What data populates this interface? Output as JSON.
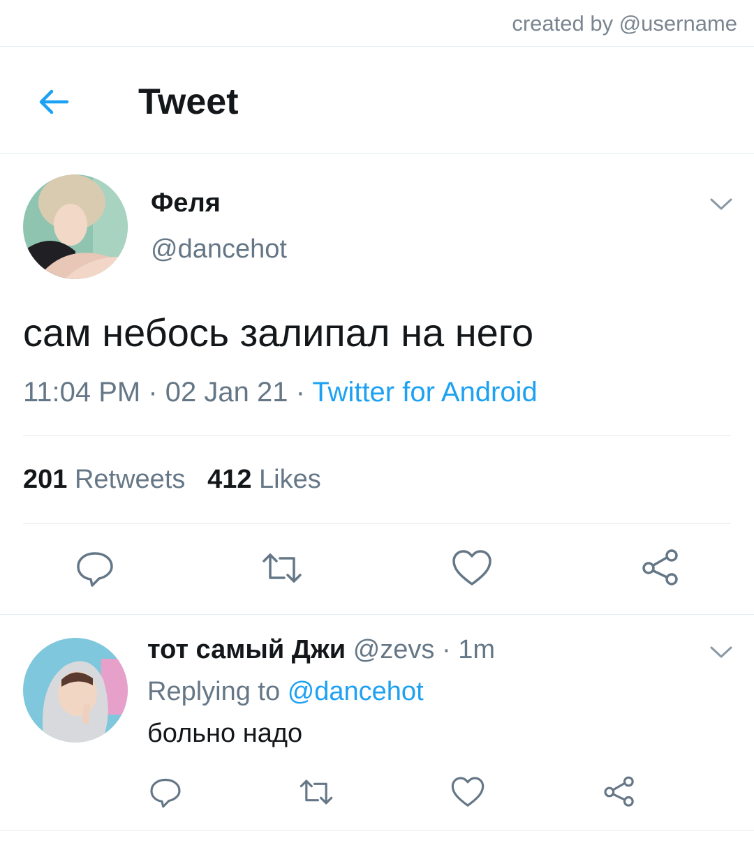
{
  "watermark": "created by @username",
  "header": {
    "back_icon": "arrow-left-icon",
    "title": "Tweet"
  },
  "colors": {
    "accent": "#1da1f2",
    "secondary_text": "#657786",
    "divider": "#e6ecf0"
  },
  "tweet": {
    "author_name": "Феля",
    "author_handle": "@dancehot",
    "text": "сам небось залипал на него",
    "time": "11:04 PM",
    "date": "02 Jan 21",
    "sep1": " · ",
    "sep2": " · ",
    "source": "Twitter for Android",
    "retweets_count": "201",
    "retweets_label": "Retweets",
    "likes_count": "412",
    "likes_label": "Likes",
    "actions": [
      "reply-icon",
      "retweet-icon",
      "like-icon",
      "share-icon"
    ]
  },
  "reply": {
    "author_name": "тот самый Джи",
    "author_handle": "@zevs",
    "separator": " · ",
    "time": "1m",
    "replying_prefix": "Replying to",
    "replying_to": "@dancehot",
    "text": "больно надо",
    "actions": [
      "reply-icon",
      "retweet-icon",
      "like-icon",
      "share-icon"
    ]
  }
}
